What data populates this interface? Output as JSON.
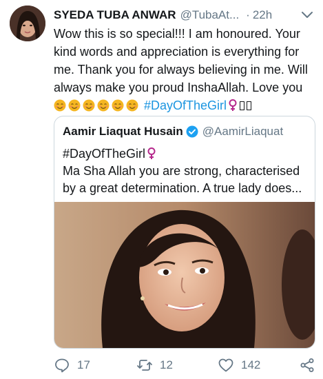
{
  "tweet": {
    "display_name": "SYEDA TUBA ANWAR",
    "handle": "@TubaAt...",
    "separator": "·",
    "time": "22h",
    "text_main": "Wow this is so special!!! I am honoured. Your kind words and appreciation is everything for me. Thank you for always believing in me. Will always make you proud InshaAllah. Love you ",
    "hashtag": "#DayOfTheGirl",
    "emoji_count": 6
  },
  "quote": {
    "display_name": "Aamir Liaquat Husain",
    "handle": "@AamirLiaquat",
    "hashtag": "#DayOfTheGirl",
    "text": "Ma Sha Allah you are strong,  characterised by a great determination. A true lady does..."
  },
  "actions": {
    "reply_count": "17",
    "retweet_count": "12",
    "like_count": "142"
  },
  "colors": {
    "link": "#1b95e0",
    "muted": "#657786",
    "border": "#ccd6dd",
    "female_symbol": "#b5288c"
  }
}
